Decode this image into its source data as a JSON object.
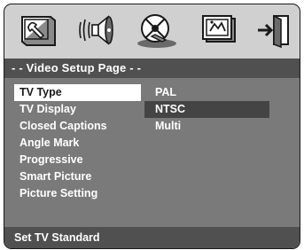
{
  "icons": [
    {
      "name": "general-setup-icon"
    },
    {
      "name": "audio-setup-icon"
    },
    {
      "name": "video-setup-icon"
    },
    {
      "name": "preference-setup-icon"
    },
    {
      "name": "exit-icon"
    }
  ],
  "header": {
    "title": "- - Video Setup Page - -"
  },
  "menu": {
    "items": [
      {
        "label": "TV Type"
      },
      {
        "label": "TV Display"
      },
      {
        "label": "Closed Captions"
      },
      {
        "label": "Angle Mark"
      },
      {
        "label": "Progressive"
      },
      {
        "label": "Smart Picture"
      },
      {
        "label": "Picture Setting"
      }
    ],
    "active_index": 0
  },
  "options": {
    "items": [
      {
        "label": "PAL"
      },
      {
        "label": "NTSC"
      },
      {
        "label": "Multi"
      }
    ],
    "selected_index": 1
  },
  "status": {
    "text": "Set TV Standard"
  },
  "colors": {
    "panel": "#d0d0d0",
    "title_bar": "#505050",
    "menu_bg": "#7a7a7a",
    "highlight": "#ffffff",
    "selected_option": "#444444"
  }
}
